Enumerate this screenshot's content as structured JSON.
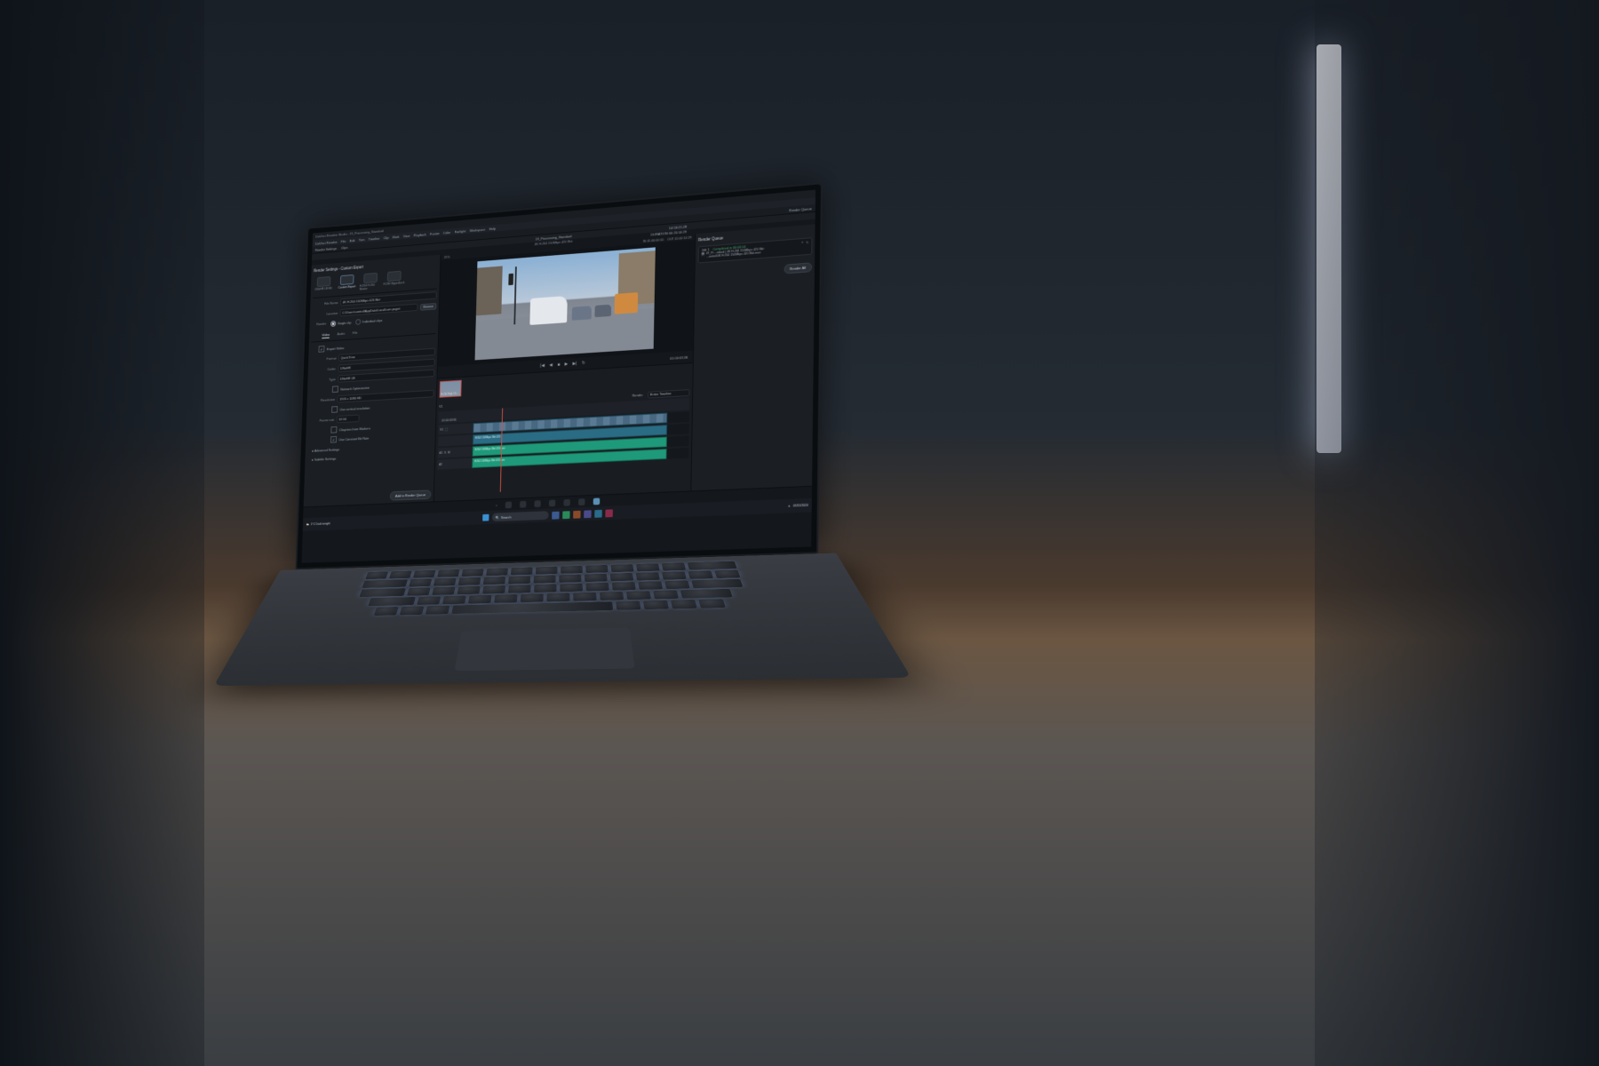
{
  "app": {
    "title": "DaVinci Resolve Studio - 19_Processing_Standard",
    "menubar": [
      "DaVinci Resolve",
      "File",
      "Edit",
      "Trim",
      "Timeline",
      "Clip",
      "Mark",
      "View",
      "Playback",
      "Fusion",
      "Color",
      "Fairlight",
      "Workspace",
      "Help"
    ]
  },
  "toolbar": {
    "render_settings_label": "Render Settings",
    "clips_label": "Clips",
    "render_queue_label": "Render Queue"
  },
  "project": {
    "name": "19_Processing_Standard",
    "format_line": "4K H.264 150Mbps 420 8bit",
    "timecode_display": "14:56:21;28",
    "duration": "00:20:14:29",
    "duration_label": "DURATION"
  },
  "viewer": {
    "fit_pct": "25%",
    "in_label": "IN",
    "in_tc": "01:00:00:00",
    "out_label": "OUT",
    "out_tc": "01:00:14:29",
    "playhead_tc": "01:00:03;36"
  },
  "render_settings": {
    "panel_title": "Render Settings - Custom Export",
    "presets": [
      {
        "label": "DNxHR LB HD"
      },
      {
        "label": "Custom Export",
        "selected": true
      },
      {
        "label": "H.264\nH.264 Master"
      },
      {
        "label": "H.265\nHyperDeck"
      }
    ],
    "filename_label": "File Name",
    "filename_value": "4K H.264 150Mbps 420 8bit",
    "location_label": "Location",
    "location_value": "C:\\Users\\control\\AppData\\Local\\com.puget",
    "browse_label": "Browse",
    "render_group_label": "Render",
    "render_mode": {
      "single": "Single clip",
      "individual": "Individual clips"
    },
    "tabs": {
      "video": "Video",
      "audio": "Audio",
      "file": "File"
    },
    "export_video_label": "Export Video",
    "format": {
      "label": "Format",
      "value": "QuickTime"
    },
    "codec": {
      "label": "Codec",
      "value": "DNxHR"
    },
    "type": {
      "label": "Type",
      "value": "DNxHR LB"
    },
    "network_opt_label": "Network Optimization",
    "resolution": {
      "label": "Resolution",
      "value": "1920 x 1080 HD"
    },
    "use_vertical_label": "Use vertical resolution",
    "frame_rate": {
      "label": "Frame rate",
      "value": "59.94"
    },
    "chapters_label": "Chapters from Markers",
    "constant_bitrate_label": "Use Constant Bit Rate",
    "advanced_label": "Advanced Settings",
    "subtitle_label": "Subtitle Settings",
    "add_queue_label": "Add to Render Queue"
  },
  "render_queue": {
    "panel_title": "Render Queue",
    "render_all_label": "Render All",
    "jobs": [
      {
        "name": "Job 1",
        "status": "Completed in 00:04:04",
        "clip": "19_Pr…ndard | 4K H.264 150Mbps 420 8bit",
        "dest": "…ontrol\\4K H.264 150Mbps 420 8bit.mov"
      }
    ]
  },
  "timeline": {
    "clip_label": "H.264 High LS…",
    "render_scope_label": "Render",
    "render_scope_value": "Entire Timeline",
    "ruler_start": "01:00:03:36",
    "tracks": {
      "v1": "V1",
      "a1": "A1",
      "a2": "A2"
    },
    "v1_clip_name": "H264 150Mbps 8bit 420",
    "a1_clip_name": "H264 150Mbps 8bit 420.wav",
    "a2_clip_name": "H264 150Mbps 8bit 420.wav"
  },
  "page_switcher": {
    "home": "⌂"
  },
  "taskbar": {
    "app_name": "DaVinci Resolve Studio 19",
    "pc_label": "1°C\nDark tonight",
    "search_placeholder": "Search",
    "time": "05/11/2024"
  },
  "colors": {
    "bg": "#14171c",
    "panel": "#1b1f24",
    "accent": "#d85042",
    "video_clip": "#2a6c84",
    "audio_clip": "#1e9a7a",
    "job_ok": "#4aa36a"
  }
}
